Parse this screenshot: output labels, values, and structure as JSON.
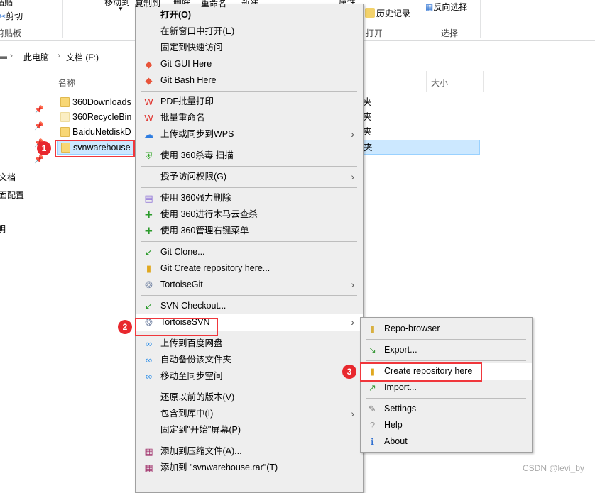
{
  "ribbon": {
    "paste": "粘贴",
    "cut": "剪切",
    "clipboard_group": "剪贴板",
    "move_to": "移动到",
    "copy_to": "复制到",
    "delete": "删除",
    "rename": "重命名",
    "new": "新建",
    "properties": "属性",
    "history": "历史记录",
    "open_group": "打开",
    "invert_selection": "反向选择",
    "select_group": "选择"
  },
  "address": {
    "crumbs": [
      "此电脑",
      "文档 (F:)"
    ]
  },
  "nav": {
    "items": [
      "文档",
      "面配置",
      "明"
    ]
  },
  "columns": {
    "name": "名称",
    "size": "大小"
  },
  "files": [
    {
      "name": "360Downloads",
      "type": "夹"
    },
    {
      "name": "360RecycleBin",
      "type": "夹"
    },
    {
      "name": "BaiduNetdiskD",
      "type": "夹"
    },
    {
      "name": "svnwarehouse",
      "type": "夹",
      "selected": true
    }
  ],
  "context_menu": [
    {
      "label": "打开(O)",
      "bold": true,
      "icon": "none"
    },
    {
      "label": "在新窗口中打开(E)",
      "icon": "none"
    },
    {
      "label": "固定到快速访问",
      "icon": "none"
    },
    {
      "label": "Git GUI Here",
      "icon": "git-icon"
    },
    {
      "label": "Git Bash Here",
      "icon": "git-icon"
    },
    {
      "sep": true
    },
    {
      "label": "PDF批量打印",
      "icon": "wps-pdf-icon"
    },
    {
      "label": "批量重命名",
      "icon": "wps-rename-icon"
    },
    {
      "label": "上传或同步到WPS",
      "icon": "cloud-upload-icon",
      "submenu": true
    },
    {
      "sep": true
    },
    {
      "label": "使用 360杀毒 扫描",
      "icon": "shield-360-icon"
    },
    {
      "sep": true
    },
    {
      "label": "授予访问权限(G)",
      "icon": "none",
      "submenu": true
    },
    {
      "sep": true
    },
    {
      "label": "使用 360强力删除",
      "icon": "shredder-icon"
    },
    {
      "label": "使用 360进行木马云查杀",
      "icon": "plus-360-icon"
    },
    {
      "label": "使用 360管理右键菜单",
      "icon": "plus-360-icon"
    },
    {
      "sep": true
    },
    {
      "label": "Git Clone...",
      "icon": "git-clone-icon"
    },
    {
      "label": "Git Create repository here...",
      "icon": "git-create-repo-icon"
    },
    {
      "label": "TortoiseGit",
      "icon": "tortoise-icon",
      "submenu": true
    },
    {
      "sep": true
    },
    {
      "label": "SVN Checkout...",
      "icon": "svn-checkout-icon"
    },
    {
      "label": "TortoiseSVN",
      "icon": "tortoise-icon",
      "submenu": true,
      "highlighted": true
    },
    {
      "sep": true
    },
    {
      "label": "上传到百度网盘",
      "icon": "baidu-netdisk-icon"
    },
    {
      "label": "自动备份该文件夹",
      "icon": "baidu-netdisk-icon"
    },
    {
      "label": "移动至同步空间",
      "icon": "baidu-netdisk-icon"
    },
    {
      "sep": true
    },
    {
      "label": "还原以前的版本(V)",
      "icon": "none"
    },
    {
      "label": "包含到库中(I)",
      "icon": "none",
      "submenu": true
    },
    {
      "label": "固定到\"开始\"屏幕(P)",
      "icon": "none"
    },
    {
      "sep": true
    },
    {
      "label": "添加到压缩文件(A)...",
      "icon": "winrar-icon"
    },
    {
      "label": "添加到 \"svnwarehouse.rar\"(T)",
      "icon": "winrar-icon"
    }
  ],
  "tortoise_submenu": [
    {
      "label": "Repo-browser",
      "icon": "repo-browser-icon"
    },
    {
      "sep": true
    },
    {
      "label": "Export...",
      "icon": "export-icon"
    },
    {
      "sep": true
    },
    {
      "label": "Create repository here",
      "icon": "create-repo-icon",
      "highlighted": true
    },
    {
      "label": "Import...",
      "icon": "import-icon"
    },
    {
      "sep": true
    },
    {
      "label": "Settings",
      "icon": "settings-icon"
    },
    {
      "label": "Help",
      "icon": "help-icon"
    },
    {
      "label": "About",
      "icon": "about-icon"
    }
  ],
  "annotations": [
    "1",
    "2",
    "3"
  ],
  "watermark": "CSDN @levi_by",
  "colors": {
    "accent_red": "#f0373c",
    "selection": "#cce8ff",
    "menu_bg": "#eeeeee"
  }
}
